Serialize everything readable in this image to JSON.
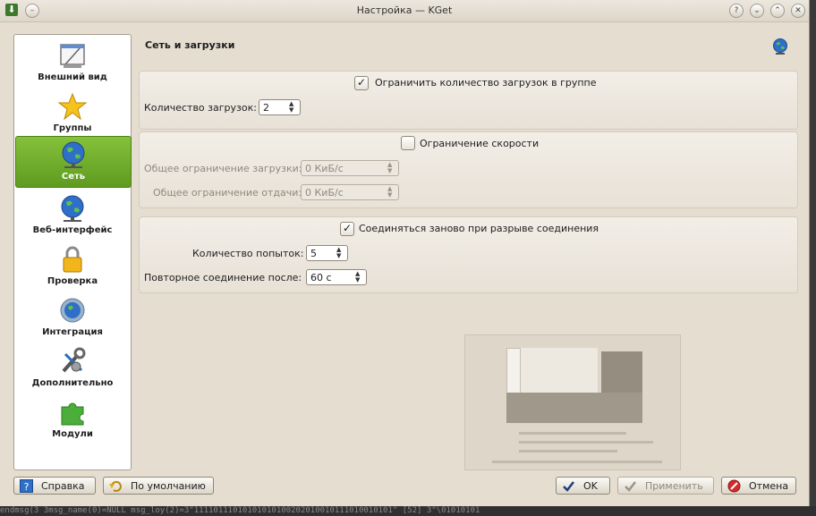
{
  "window": {
    "title": "Настройка — KGet"
  },
  "sidebar": {
    "items": [
      {
        "label": "Внешний вид",
        "icon": "appearance-icon"
      },
      {
        "label": "Группы",
        "icon": "star-icon"
      },
      {
        "label": "Сеть",
        "icon": "globe-network-icon",
        "selected": true
      },
      {
        "label": "Веб-интерфейс",
        "icon": "globe-web-icon"
      },
      {
        "label": "Проверка",
        "icon": "lock-icon"
      },
      {
        "label": "Интеграция",
        "icon": "globe-gear-icon"
      },
      {
        "label": "Дополнительно",
        "icon": "tools-icon"
      },
      {
        "label": "Модули",
        "icon": "puzzle-icon"
      }
    ]
  },
  "page": {
    "title": "Сеть и загрузки"
  },
  "group_limit": {
    "checkbox_label": "Ограничить количество загрузок в группе",
    "checked": true,
    "count_label": "Количество загрузок:",
    "count_value": "2"
  },
  "group_speed": {
    "checkbox_label": "Ограничение скорости",
    "checked": false,
    "download_label": "Общее ограничение загрузки:",
    "download_value": "0 КиБ/с",
    "upload_label": "Общее ограничение отдачи:",
    "upload_value": "0 КиБ/с"
  },
  "group_reconnect": {
    "checkbox_label": "Соединяться заново при разрыве соединения",
    "checked": true,
    "attempts_label": "Количество попыток:",
    "attempts_value": "5",
    "delay_label": "Повторное соединение после:",
    "delay_value": "60 с"
  },
  "buttons": {
    "help": "Справка",
    "defaults": "По умолчанию",
    "ok": "OK",
    "apply": "Применить",
    "cancel": "Отмена"
  },
  "colors": {
    "selected_item": "#6aab26",
    "window_bg": "#e4ddd0"
  },
  "terminal": {
    "text": "endmsg(3 3msg_name(0)=NULL msg_loy(2)=3\"11110111010101010100202010010111010010101\"  [52]  3\"\\01010101"
  }
}
